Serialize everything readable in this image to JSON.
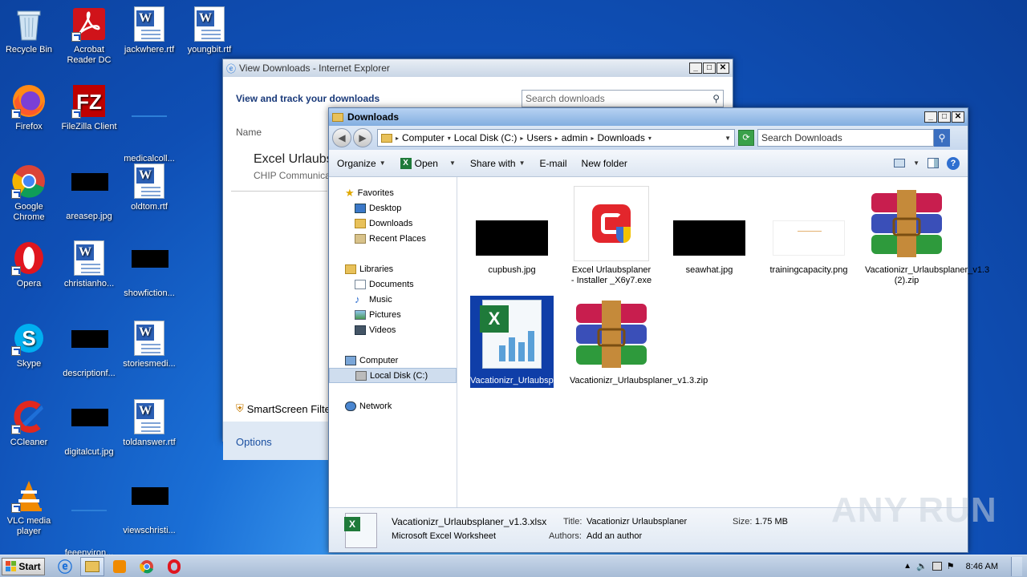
{
  "desktop": {
    "icons": [
      {
        "label": "Recycle Bin",
        "icon": "recycle-bin-icon"
      },
      {
        "label": "Acrobat Reader DC",
        "icon": "acrobat-icon"
      },
      {
        "label": "jackwhere.rtf",
        "icon": "word-doc-icon"
      },
      {
        "label": "youngbit.rtf",
        "icon": "word-doc-icon"
      },
      {
        "label": "Firefox",
        "icon": "firefox-icon"
      },
      {
        "label": "FileZilla Client",
        "icon": "filezilla-icon"
      },
      {
        "label": "medicalcoll...",
        "icon": "blank-file-icon"
      },
      {
        "label": "Google Chrome",
        "icon": "chrome-icon"
      },
      {
        "label": "areasep.jpg",
        "icon": "image-thumb-icon"
      },
      {
        "label": "oldtom.rtf",
        "icon": "word-doc-icon"
      },
      {
        "label": "Opera",
        "icon": "opera-icon"
      },
      {
        "label": "christianho...",
        "icon": "word-doc-icon"
      },
      {
        "label": "showfiction...",
        "icon": "image-thumb-icon"
      },
      {
        "label": "Skype",
        "icon": "skype-icon"
      },
      {
        "label": "descriptionf...",
        "icon": "image-thumb-icon"
      },
      {
        "label": "storiesmedi...",
        "icon": "word-doc-icon"
      },
      {
        "label": "CCleaner",
        "icon": "ccleaner-icon"
      },
      {
        "label": "digitalcut.jpg",
        "icon": "image-thumb-icon"
      },
      {
        "label": "toldanswer.rtf",
        "icon": "word-doc-icon"
      },
      {
        "label": "VLC media player",
        "icon": "vlc-icon"
      },
      {
        "label": "feeenviron...",
        "icon": "blank-file-icon"
      },
      {
        "label": "viewschristi...",
        "icon": "image-thumb-icon"
      }
    ]
  },
  "ie_window": {
    "title": "View Downloads - Internet Explorer",
    "heading": "View and track your downloads",
    "search_placeholder": "Search downloads",
    "col_name": "Name",
    "item_name": "Excel Urlaubs",
    "item_publisher": "CHIP Communica",
    "smartscreen": "SmartScreen Filte",
    "options": "Options"
  },
  "explorer": {
    "title": "Downloads",
    "breadcrumb": [
      "Computer",
      "Local Disk (C:)",
      "Users",
      "admin",
      "Downloads"
    ],
    "search_placeholder": "Search Downloads",
    "toolbar": {
      "organize": "Organize",
      "open": "Open",
      "share": "Share with",
      "email": "E-mail",
      "new_folder": "New folder"
    },
    "nav": {
      "favorites": "Favorites",
      "desktop": "Desktop",
      "downloads": "Downloads",
      "recent": "Recent Places",
      "libraries": "Libraries",
      "documents": "Documents",
      "music": "Music",
      "pictures": "Pictures",
      "videos": "Videos",
      "computer": "Computer",
      "local_disk": "Local Disk (C:)",
      "network": "Network"
    },
    "files": [
      {
        "name": "cupbush.jpg"
      },
      {
        "name": "Excel Urlaubsplaner - Installer _X6y7.exe"
      },
      {
        "name": "seawhat.jpg"
      },
      {
        "name": "trainingcapacity.png"
      },
      {
        "name": "Vacationizr_Urlaubsplaner_v1.3 (2).zip"
      },
      {
        "name": "Vacationizr_Urlaubsplaner_v1.3.xlsx"
      },
      {
        "name": "Vacationizr_Urlaubsplaner_v1.3.zip"
      }
    ],
    "details": {
      "filename": "Vacationizr_Urlaubsplaner_v1.3.xlsx",
      "filetype": "Microsoft Excel Worksheet",
      "title_label": "Title:",
      "title_value": "Vacationizr Urlaubsplaner",
      "size_label": "Size:",
      "size_value": "1.75 MB",
      "authors_label": "Authors:",
      "authors_value": "Add an author"
    }
  },
  "taskbar": {
    "start": "Start",
    "clock": "8:46 AM"
  },
  "watermark": "ANY RUN"
}
